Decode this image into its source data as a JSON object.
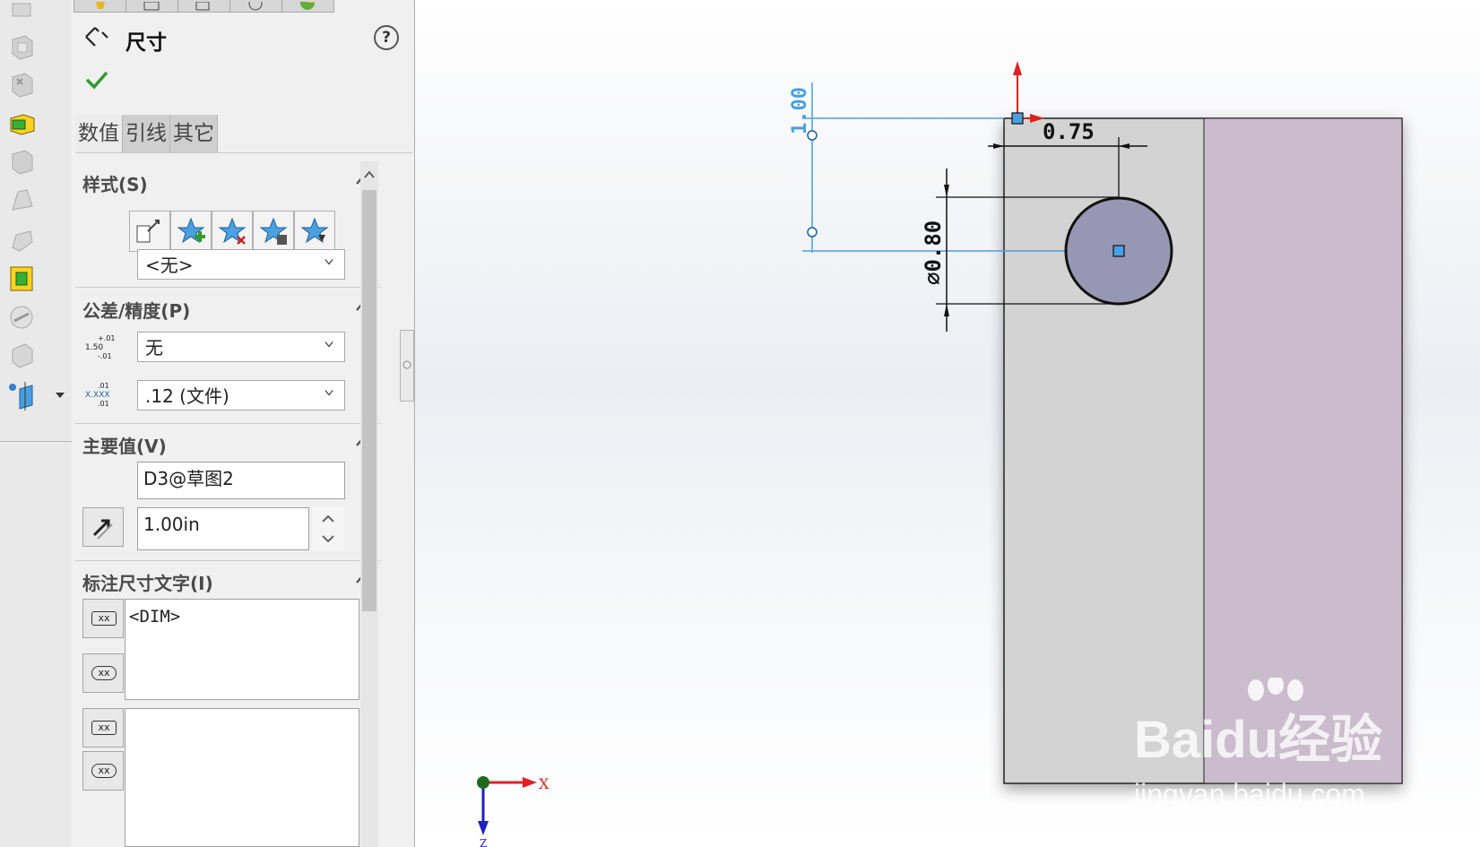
{
  "property_manager": {
    "title": "尺寸",
    "help": "?",
    "tabs": [
      "数值",
      "引线",
      "其它"
    ],
    "style_section": {
      "title": "样式(S)",
      "favorite_value": "<无>"
    },
    "tolerance_section": {
      "title": "公差/精度(P)",
      "tolerance_type": "无",
      "precision": ".12 (文件)",
      "tol_icon_top": "+.01",
      "tol_icon_mid": "1.50",
      "tol_icon_bot": "-.01",
      "prec_icon_top": ".01",
      "prec_icon_mid": "X.XXX",
      "prec_icon_bot": ".01"
    },
    "primary_value_section": {
      "title": "主要值(V)",
      "name": "D3@草图2",
      "value": "1.00in"
    },
    "dimension_text_section": {
      "title": "标注尺寸文字(I)",
      "text": "<DIM>",
      "btn_label": "xx"
    }
  },
  "drawing": {
    "dim_vertical": "1.00",
    "dim_horizontal": "0.75",
    "dim_diameter": "⌀0.80",
    "axis_x": "X",
    "axis_z": "Z"
  },
  "watermark": {
    "brand": "Baidu经验",
    "url": "jingyan.baidu.com"
  }
}
